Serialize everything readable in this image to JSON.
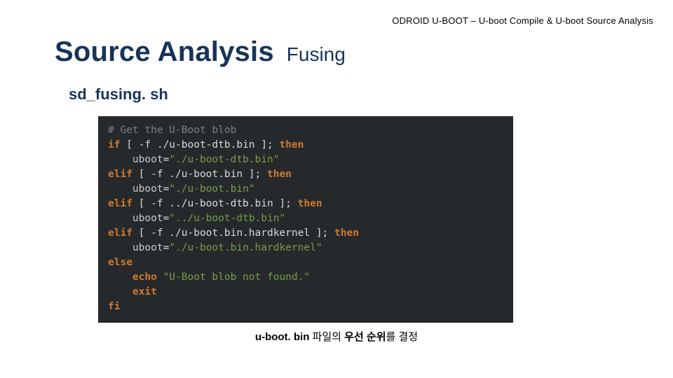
{
  "header_small": "ODROID U-BOOT – U-boot Compile & U-boot Source Analysis",
  "title_main": "Source Analysis",
  "title_sub": "Fusing",
  "subheading": "sd_fusing. sh",
  "code": {
    "comment": "# Get the U-Boot blob",
    "l1a": "if",
    "l1b": " [ -f ./u-boot-dtb.bin ]; ",
    "l1c": "then",
    "l2a": "uboot",
    "l2b": "=",
    "l2c": "\"./u-boot-dtb.bin\"",
    "l3a": "elif",
    "l3b": " [ -f ./u-boot.bin ]; ",
    "l3c": "then",
    "l4a": "uboot",
    "l4b": "=",
    "l4c": "\"./u-boot.bin\"",
    "l5a": "elif",
    "l5b": " [ -f ../u-boot-dtb.bin ]; ",
    "l5c": "then",
    "l6a": "uboot",
    "l6b": "=",
    "l6c": "\"../u-boot-dtb.bin\"",
    "l7a": "elif",
    "l7b": " [ -f ./u-boot.bin.hardkernel ]; ",
    "l7c": "then",
    "l8a": "uboot",
    "l8b": "=",
    "l8c": "\"./u-boot.bin.hardkernel\"",
    "l9": "else",
    "l10a": "echo",
    "l10b": " ",
    "l10c": "\"U-Boot blob not found.\"",
    "l11": "exit",
    "l12": "fi",
    "indent": "    "
  },
  "caption": {
    "pre_bold": "u-boot. bin",
    "mid_plain": " 파일의 ",
    "bold2": "우선 순위",
    "tail": "를 결정"
  }
}
